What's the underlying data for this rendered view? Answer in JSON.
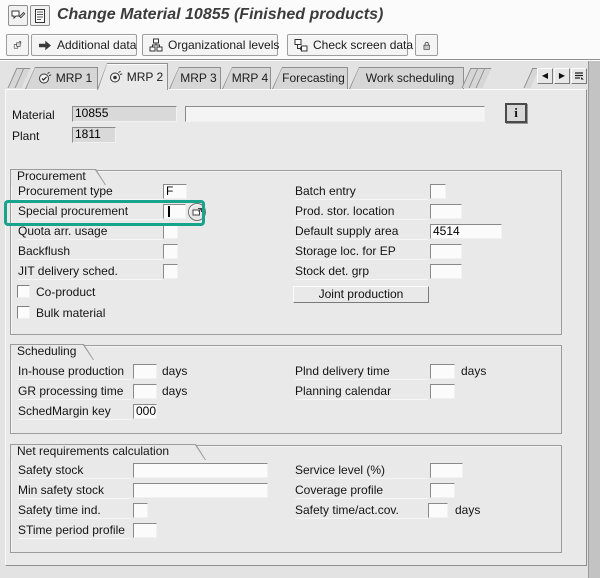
{
  "window": {
    "title": "Change Material 10855 (Finished products)"
  },
  "colors": {
    "highlight_box": "#17A38C"
  },
  "icons": {
    "prev_tab": "◀",
    "next_tab": "▶",
    "info": "i"
  },
  "toolbar": {
    "additional_data": "Additional data",
    "organizational_levels": "Organizational levels",
    "check_screen_data": "Check screen data"
  },
  "tabs": {
    "items": [
      {
        "label": "MRP 1"
      },
      {
        "label": "MRP 2"
      },
      {
        "label": "MRP 3"
      },
      {
        "label": "MRP 4"
      },
      {
        "label": "Forecasting"
      },
      {
        "label": "Work scheduling"
      }
    ],
    "active": "MRP 2"
  },
  "header": {
    "material_label": "Material",
    "material_value": "10855",
    "material_desc": "",
    "plant_label": "Plant",
    "plant_value": "1811"
  },
  "sections": {
    "procurement": {
      "title": "Procurement",
      "left": [
        {
          "label": "Procurement type",
          "value": "F"
        },
        {
          "label": "Special procurement",
          "value": ""
        },
        {
          "label": "Quota arr. usage",
          "value": ""
        },
        {
          "label": "Backflush",
          "value": ""
        },
        {
          "label": "JIT delivery sched.",
          "value": ""
        }
      ],
      "checkboxes": [
        {
          "label": "Co-product",
          "checked": false
        },
        {
          "label": "Bulk material",
          "checked": false
        }
      ],
      "right": [
        {
          "label": "Batch entry",
          "value": ""
        },
        {
          "label": "Prod. stor. location",
          "value": ""
        },
        {
          "label": "Default supply area",
          "value": "4514"
        },
        {
          "label": "Storage loc. for EP",
          "value": ""
        },
        {
          "label": "Stock det. grp",
          "value": ""
        }
      ],
      "button": "Joint production"
    },
    "scheduling": {
      "title": "Scheduling",
      "left": [
        {
          "label": "In-house production",
          "value": "",
          "unit": "days"
        },
        {
          "label": "GR processing time",
          "value": "",
          "unit": "days"
        },
        {
          "label": "SchedMargin key",
          "value": "000",
          "unit": ""
        }
      ],
      "right": [
        {
          "label": "Plnd delivery time",
          "value": "",
          "unit": "days"
        },
        {
          "label": "Planning calendar",
          "value": "",
          "unit": ""
        }
      ]
    },
    "net_requirements": {
      "title": "Net requirements calculation",
      "left": [
        {
          "label": "Safety stock",
          "value": ""
        },
        {
          "label": "Min safety stock",
          "value": ""
        },
        {
          "label": "Safety time ind.",
          "value": ""
        },
        {
          "label": "STime period profile",
          "value": ""
        }
      ],
      "right": [
        {
          "label": "Service level (%)",
          "value": ""
        },
        {
          "label": "Coverage profile",
          "value": ""
        },
        {
          "label": "Safety time/act.cov.",
          "value": "",
          "unit": "days"
        }
      ]
    }
  }
}
